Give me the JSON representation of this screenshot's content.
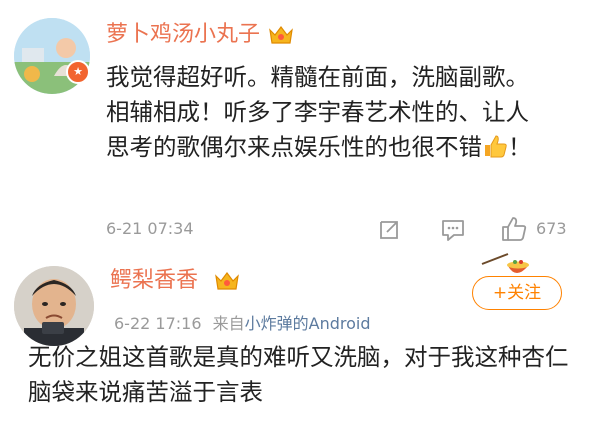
{
  "comments": [
    {
      "username": "萝卜鸡汤小丸子",
      "text": "我觉得超好听。精髓在前面，洗脑副歌。相辅相成！听多了李宇春艺术性的、让人思考的歌偶尔来点娱乐性的也很不错",
      "text_suffix": "！",
      "timestamp": "6-21 07:34",
      "like_count": "673"
    },
    {
      "username": "鳄梨香香",
      "timestamp": "6-22 17:16",
      "source_prefix": "来自",
      "source": "小炸弹的Android",
      "follow_label": "+关注",
      "text": "无价之姐这首歌是真的难听又洗脑，对于我这种杏仁脑袋来说痛苦溢于言表"
    }
  ],
  "icons": [
    "crown-icon",
    "thumbs-up-emoji-icon",
    "repost-icon",
    "reply-icon",
    "like-icon",
    "food-sticker-icon"
  ],
  "colors": {
    "username": "#eb7350",
    "follow": "#ff8200",
    "source_link": "#5d7b9f",
    "meta": "#9a9a9a"
  }
}
